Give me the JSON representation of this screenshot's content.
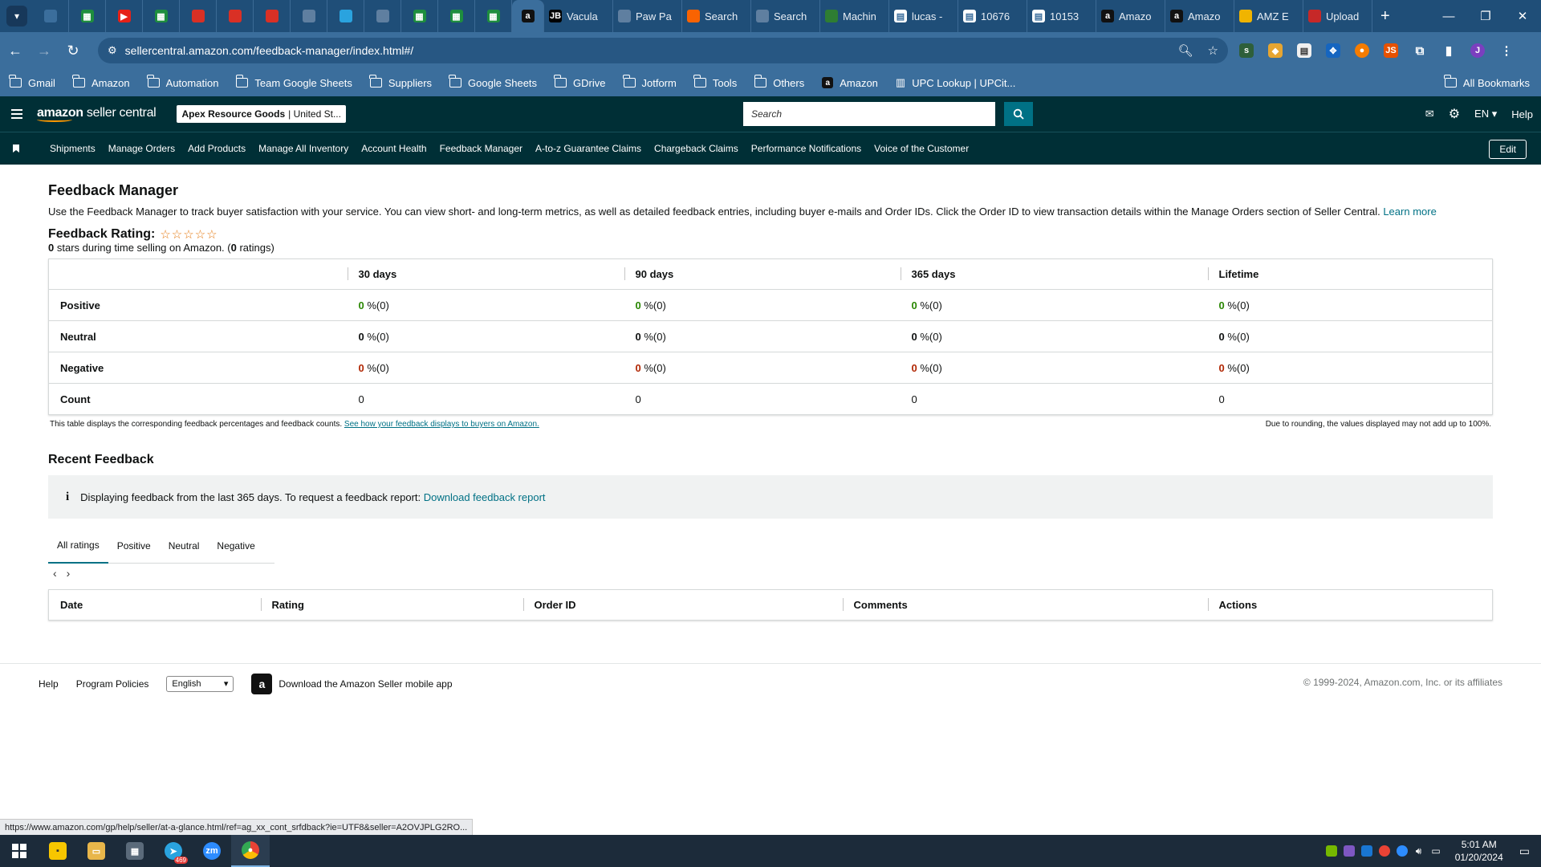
{
  "browser": {
    "tabs": [
      {
        "label": "",
        "icon": "paper-plane-icon",
        "color": "#3b6e9c"
      },
      {
        "label": "",
        "icon": "google-sheets-icon",
        "color": "#1e8e3e"
      },
      {
        "label": "",
        "icon": "youtube-icon",
        "color": "#e62117"
      },
      {
        "label": "",
        "icon": "google-sheets-icon",
        "color": "#1e8e3e"
      },
      {
        "label": "",
        "icon": "gmail-icon",
        "color": "#d93025"
      },
      {
        "label": "",
        "icon": "gmail-icon",
        "color": "#d93025"
      },
      {
        "label": "",
        "icon": "gmail-icon",
        "color": "#d93025"
      },
      {
        "label": "",
        "icon": "speaker-icon",
        "color": "#5f7fa0"
      },
      {
        "label": "",
        "icon": "telegram-icon",
        "color": "#2aa3df"
      },
      {
        "label": "",
        "icon": "chart-icon",
        "color": "#5f7fa0"
      },
      {
        "label": "",
        "icon": "google-sheets-icon",
        "color": "#1e8e3e"
      },
      {
        "label": "",
        "icon": "google-sheets-icon",
        "color": "#1e8e3e"
      },
      {
        "label": "",
        "icon": "google-sheets-icon",
        "color": "#1e8e3e"
      },
      {
        "label": "",
        "icon": "amazon-icon",
        "color": "#111111",
        "active": true
      },
      {
        "label": "Vacula",
        "icon": "jetbrains-icon",
        "color": "#000000"
      },
      {
        "label": "Paw Pa",
        "icon": "loading-icon",
        "color": "#5f7fa0"
      },
      {
        "label": "Search",
        "icon": "home-depot-icon",
        "color": "#f96302"
      },
      {
        "label": "Search",
        "icon": "loading-icon",
        "color": "#5f7fa0"
      },
      {
        "label": "Machin",
        "icon": "w-icon",
        "color": "#2e7d32"
      },
      {
        "label": "lucas -",
        "icon": "doc-icon",
        "color": "#ffffff"
      },
      {
        "label": "10676",
        "icon": "doc-icon",
        "color": "#ffffff"
      },
      {
        "label": "10153",
        "icon": "doc-icon",
        "color": "#ffffff"
      },
      {
        "label": "Amazo",
        "icon": "amazon-icon",
        "color": "#111111"
      },
      {
        "label": "Amazo",
        "icon": "amazon-icon",
        "color": "#111111"
      },
      {
        "label": "AMZ E",
        "icon": "amz-icon",
        "color": "#f0b400"
      },
      {
        "label": "Upload",
        "icon": "shield-icon",
        "color": "#c62828"
      }
    ],
    "url": "sellercentral.amazon.com/feedback-manager/index.html#/",
    "bookmarks": [
      "Gmail",
      "Amazon",
      "Automation",
      "Team Google Sheets",
      "Suppliers",
      "Google Sheets",
      "GDrive",
      "Jotform",
      "Tools",
      "Others",
      "Amazon",
      "UPC Lookup | UPCit..."
    ],
    "all_bookmarks": "All Bookmarks",
    "profile_initial": "J",
    "status_url": "https://www.amazon.com/gp/help/seller/at-a-glance.html/ref=ag_xx_cont_srfdback?ie=UTF8&seller=A2OVJPLG2RO..."
  },
  "header": {
    "logo_amazon": "amazon",
    "logo_seller": " seller central",
    "store_name": "Apex Resource Goods",
    "store_market": "| United St...",
    "search_placeholder": "Search",
    "language": "EN",
    "help": "Help"
  },
  "nav": {
    "items": [
      "Shipments",
      "Manage Orders",
      "Add Products",
      "Manage All Inventory",
      "Account Health",
      "Feedback Manager",
      "A-to-z Guarantee Claims",
      "Chargeback Claims",
      "Performance Notifications",
      "Voice of the Customer"
    ],
    "edit": "Edit"
  },
  "page": {
    "title": "Feedback Manager",
    "intro": "Use the Feedback Manager to track buyer satisfaction with your service. You can view short- and long-term metrics, as well as detailed feedback entries, including buyer e-mails and Order IDs. Click the Order ID to view transaction details within the Manage Orders section of Seller Central. ",
    "learn_more": "Learn more",
    "rating_title": "Feedback Rating:",
    "stars": "☆☆☆☆☆",
    "rating_value": "0",
    "rating_sub_mid": " stars during time selling on Amazon. (",
    "rating_count": "0",
    "rating_sub_end": " ratings)"
  },
  "feedback_table": {
    "columns": [
      "30 days",
      "90 days",
      "365 days",
      "Lifetime"
    ],
    "rows": [
      {
        "label": "Positive",
        "kind": "pos",
        "cells": [
          {
            "v": "0",
            "s": " %(0)"
          },
          {
            "v": "0",
            "s": " %(0)"
          },
          {
            "v": "0",
            "s": " %(0)"
          },
          {
            "v": "0",
            "s": " %(0)"
          }
        ]
      },
      {
        "label": "Neutral",
        "kind": "neu",
        "cells": [
          {
            "v": "0",
            "s": " %(0)"
          },
          {
            "v": "0",
            "s": " %(0)"
          },
          {
            "v": "0",
            "s": " %(0)"
          },
          {
            "v": "0",
            "s": " %(0)"
          }
        ]
      },
      {
        "label": "Negative",
        "kind": "neg",
        "cells": [
          {
            "v": "0",
            "s": " %(0)"
          },
          {
            "v": "0",
            "s": " %(0)"
          },
          {
            "v": "0",
            "s": " %(0)"
          },
          {
            "v": "0",
            "s": " %(0)"
          }
        ]
      },
      {
        "label": "Count",
        "kind": "count",
        "cells": [
          {
            "v": "0",
            "s": ""
          },
          {
            "v": "0",
            "s": ""
          },
          {
            "v": "0",
            "s": ""
          },
          {
            "v": "0",
            "s": ""
          }
        ]
      }
    ],
    "foot_text": "This table displays the corresponding feedback percentages and feedback counts. ",
    "foot_link": "See how your feedback displays to buyers on Amazon.",
    "rounding_note": "Due to rounding, the values displayed may not add up to 100%."
  },
  "recent": {
    "title": "Recent Feedback",
    "info_text": "Displaying feedback from the last 365 days. To request a feedback report: ",
    "info_link": "Download feedback report",
    "tabs": [
      "All ratings",
      "Positive",
      "Neutral",
      "Negative"
    ],
    "columns": [
      "Date",
      "Rating",
      "Order ID",
      "Comments",
      "Actions"
    ]
  },
  "footer": {
    "help": "Help",
    "policies": "Program Policies",
    "language": "English",
    "app_text": "Download the Amazon Seller mobile app",
    "copyright": "© 1999-2024, Amazon.com, Inc. or its affiliates"
  },
  "taskbar": {
    "time": "5:01 AM",
    "date": "01/20/2024",
    "telegram_badge": "469"
  },
  "colors": {
    "positive": "#2a8703",
    "negative": "#b12704",
    "header_bg": "#002f36",
    "link": "#007185"
  }
}
